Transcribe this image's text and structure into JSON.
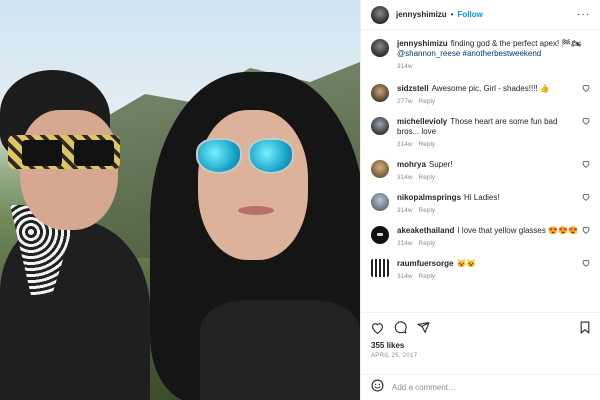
{
  "post": {
    "author": "jennyshimizu",
    "follow_label": "Follow",
    "dot": "•",
    "menu": "···",
    "caption": {
      "username": "jennyshimizu",
      "text": "finding god & the perfect apex! 🏁🏍",
      "mention": "@shannon_reese",
      "hashtag": "#anotherbestweekend",
      "time": "314w"
    }
  },
  "comments": [
    {
      "username": "sidzstell",
      "text": "Awesome pic, Girl - shades!!!! 👍",
      "time": "277w",
      "reply": "Reply",
      "avatar_class": "av-1"
    },
    {
      "username": "michellevioly",
      "text": "Those heart are some fun bad bros... love",
      "time": "314w",
      "reply": "Reply",
      "avatar_class": "av-2"
    },
    {
      "username": "mohrya",
      "text": "Super!",
      "time": "314w",
      "reply": "Reply",
      "avatar_class": "av-3"
    },
    {
      "username": "nikopalmsprings",
      "text": "Hi Ladies!",
      "time": "314w",
      "reply": "Reply",
      "avatar_class": "av-4"
    },
    {
      "username": "akeakethailand",
      "text": "I love that yellow glasses 😍😍😍",
      "time": "314w",
      "reply": "Reply",
      "avatar_class": "av-5"
    },
    {
      "username": "raumfuersorge",
      "text": "😺😺",
      "time": "314w",
      "reply": "Reply",
      "avatar_class": "av-6"
    }
  ],
  "actions": {
    "like_icon": "heart-icon",
    "comment_icon": "comment-icon",
    "share_icon": "share-icon",
    "save_icon": "bookmark-icon"
  },
  "likes": "355 likes",
  "date": "APRIL 25, 2017",
  "add_comment": {
    "placeholder": "Add a comment…",
    "emoji_icon": "emoji-icon"
  },
  "colors": {
    "accent": "#0095f6",
    "muted": "#8e8e8e",
    "text": "#262626",
    "link": "#00376b"
  }
}
